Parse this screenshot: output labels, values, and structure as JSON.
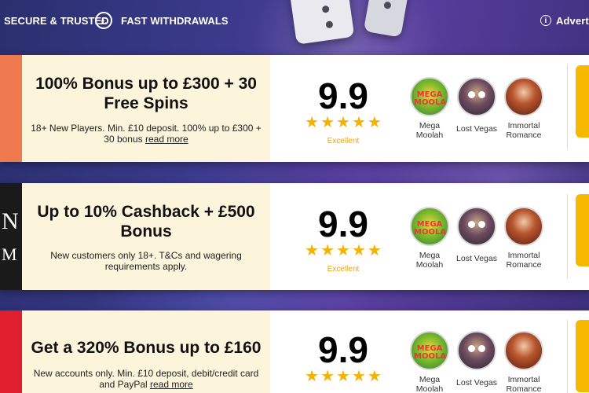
{
  "topbar": {
    "secure": "SECURE & TRUSTED",
    "pound_symbol": "£",
    "fast": "FAST WITHDRAWALS",
    "info_symbol": "i",
    "advertising": "Advertis"
  },
  "offers": [
    {
      "logo_text": "",
      "logo_color": "#f07a50",
      "title": "100% Bonus up to £300 + 30 Free Spins",
      "terms": "18+ New Players. Min. £10 deposit. 100% up to £300 + 30 bonus",
      "read_more": "read more",
      "score": "9.9",
      "stars": 5,
      "rating_label": "Excellent",
      "games": [
        "Mega Moolah",
        "Lost Vegas",
        "Immortal Romance"
      ]
    },
    {
      "logo_text": "N",
      "logo_text_2": "M",
      "logo_color": "#1a1a1a",
      "title": "Up to 10% Cashback + £500 Bonus",
      "terms": "New customers only 18+. T&Cs and wagering requirements apply.",
      "read_more": "",
      "score": "9.9",
      "stars": 5,
      "rating_label": "Excellent",
      "games": [
        "Mega Moolah",
        "Lost Vegas",
        "Immortal Romance"
      ]
    },
    {
      "logo_text": "",
      "logo_color": "#e01e2e",
      "title": "Get a 320% Bonus up to £160",
      "terms": "New accounts only. Min. £10 deposit, debit/credit card and PayPal",
      "read_more": "read more",
      "score": "9.9",
      "stars": 5,
      "rating_label": "",
      "games": [
        "Mega Moolah",
        "Lost Vegas",
        "Immortal Romance"
      ]
    }
  ],
  "colors": {
    "accent_star": "#f5b300",
    "cta": "#f6b800",
    "bonus_bg": "#fdf4dc"
  },
  "icons": [
    "pound-icon",
    "info-icon",
    "star-icon"
  ]
}
